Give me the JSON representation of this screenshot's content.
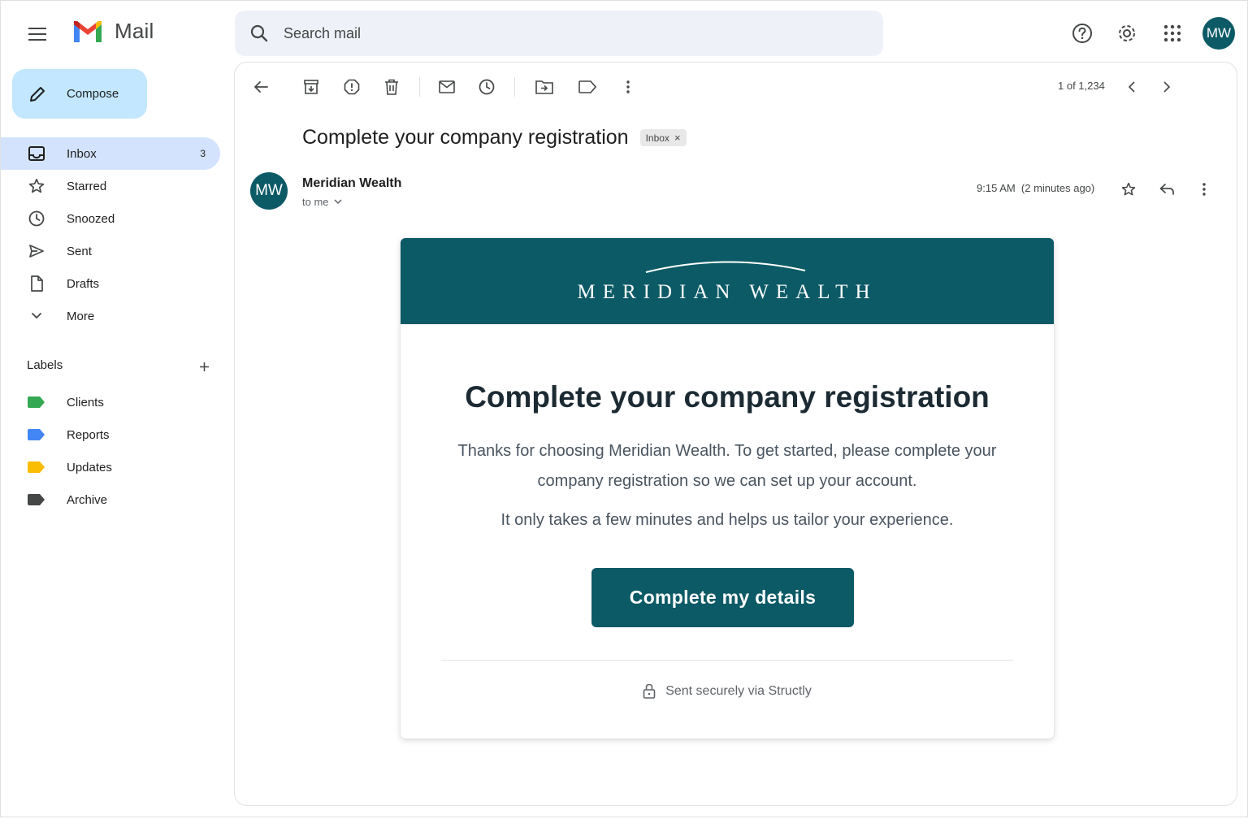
{
  "app": {
    "name": "Mail"
  },
  "search": {
    "placeholder": "Search mail"
  },
  "user": {
    "initials": "MW"
  },
  "compose": {
    "label": "Compose"
  },
  "nav": {
    "items": [
      {
        "label": "Inbox",
        "count": "3",
        "icon": "inbox-icon",
        "active": true
      },
      {
        "label": "Starred",
        "icon": "star-icon"
      },
      {
        "label": "Snoozed",
        "icon": "clock-icon"
      },
      {
        "label": "Sent",
        "icon": "send-icon"
      },
      {
        "label": "Drafts",
        "icon": "draft-icon"
      },
      {
        "label": "More",
        "icon": "chevron-down-icon"
      }
    ]
  },
  "labels": {
    "title": "Labels",
    "items": [
      {
        "name": "Clients",
        "color": "#34a853"
      },
      {
        "name": "Reports",
        "color": "#4285f4"
      },
      {
        "name": "Updates",
        "color": "#fbbc04"
      },
      {
        "name": "Archive",
        "color": "#444746"
      }
    ]
  },
  "toolbar": {
    "pager": "1 of 1,234"
  },
  "message": {
    "subject": "Complete your company registration",
    "chip": "Inbox",
    "sender_initials": "MW",
    "sender": "Meridian Wealth",
    "to": "to me",
    "time": "9:15 AM  (2 minutes ago)"
  },
  "email": {
    "brand": "MERIDIAN WEALTH",
    "title": "Complete your company registration",
    "body1": "Thanks for choosing Meridian Wealth. To get started, please complete your company registration so we can set up your account.",
    "body2": "It only takes a few minutes and helps us tailor your experience.",
    "cta": "Complete my details",
    "footer": "Sent securely via Structly"
  },
  "colors": {
    "brand": "#0c5a66",
    "active_nav": "#d3e3fd",
    "compose": "#c2e7ff",
    "search_bg": "#eef2f8"
  }
}
